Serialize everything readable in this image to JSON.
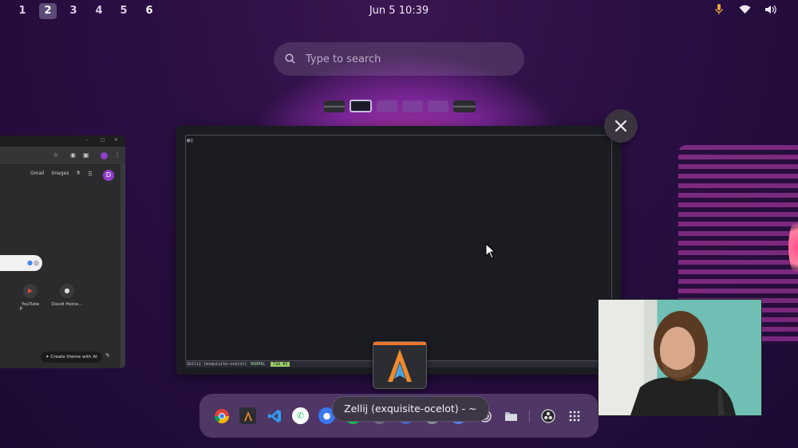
{
  "topbar": {
    "workspaces": [
      "1",
      "2",
      "3",
      "4",
      "5",
      "6"
    ],
    "active_workspace": "2",
    "clock": "Jun 5  10:39",
    "tray_icons": [
      "microphone-icon",
      "wifi-icon",
      "volume-icon"
    ]
  },
  "search": {
    "placeholder": "Type to search"
  },
  "chrome_window": {
    "links": [
      "Gmail",
      "Images"
    ],
    "avatar_letter": "D",
    "shortcuts": [
      {
        "label": "p"
      },
      {
        "label": "YouTube"
      },
      {
        "label": "David Heine..."
      }
    ],
    "theme_button": "Create theme with AI"
  },
  "terminal": {
    "session": "Zellij (exquisite-ocelot)",
    "mode": "NORMAL",
    "tab": "Tab #1"
  },
  "tooltip": "Zellij (exquisite-ocelot) - ~",
  "dock": {
    "apps": [
      "chrome-icon",
      "alacritty-icon",
      "vscode-icon",
      "whatsapp-icon",
      "signal-icon",
      "spotify-icon",
      "app-icon",
      "app-icon",
      "app-icon",
      "app-icon",
      "settings-icon",
      "files-icon",
      "obs-icon",
      "app-grid-icon"
    ]
  },
  "colors": {
    "background": "#2a0f44",
    "accent_purple": "#8f3fc8",
    "terminal_bg": "#1b1b22",
    "tab_green": "#9ccc65",
    "mic_orange": "#e9a23b"
  }
}
